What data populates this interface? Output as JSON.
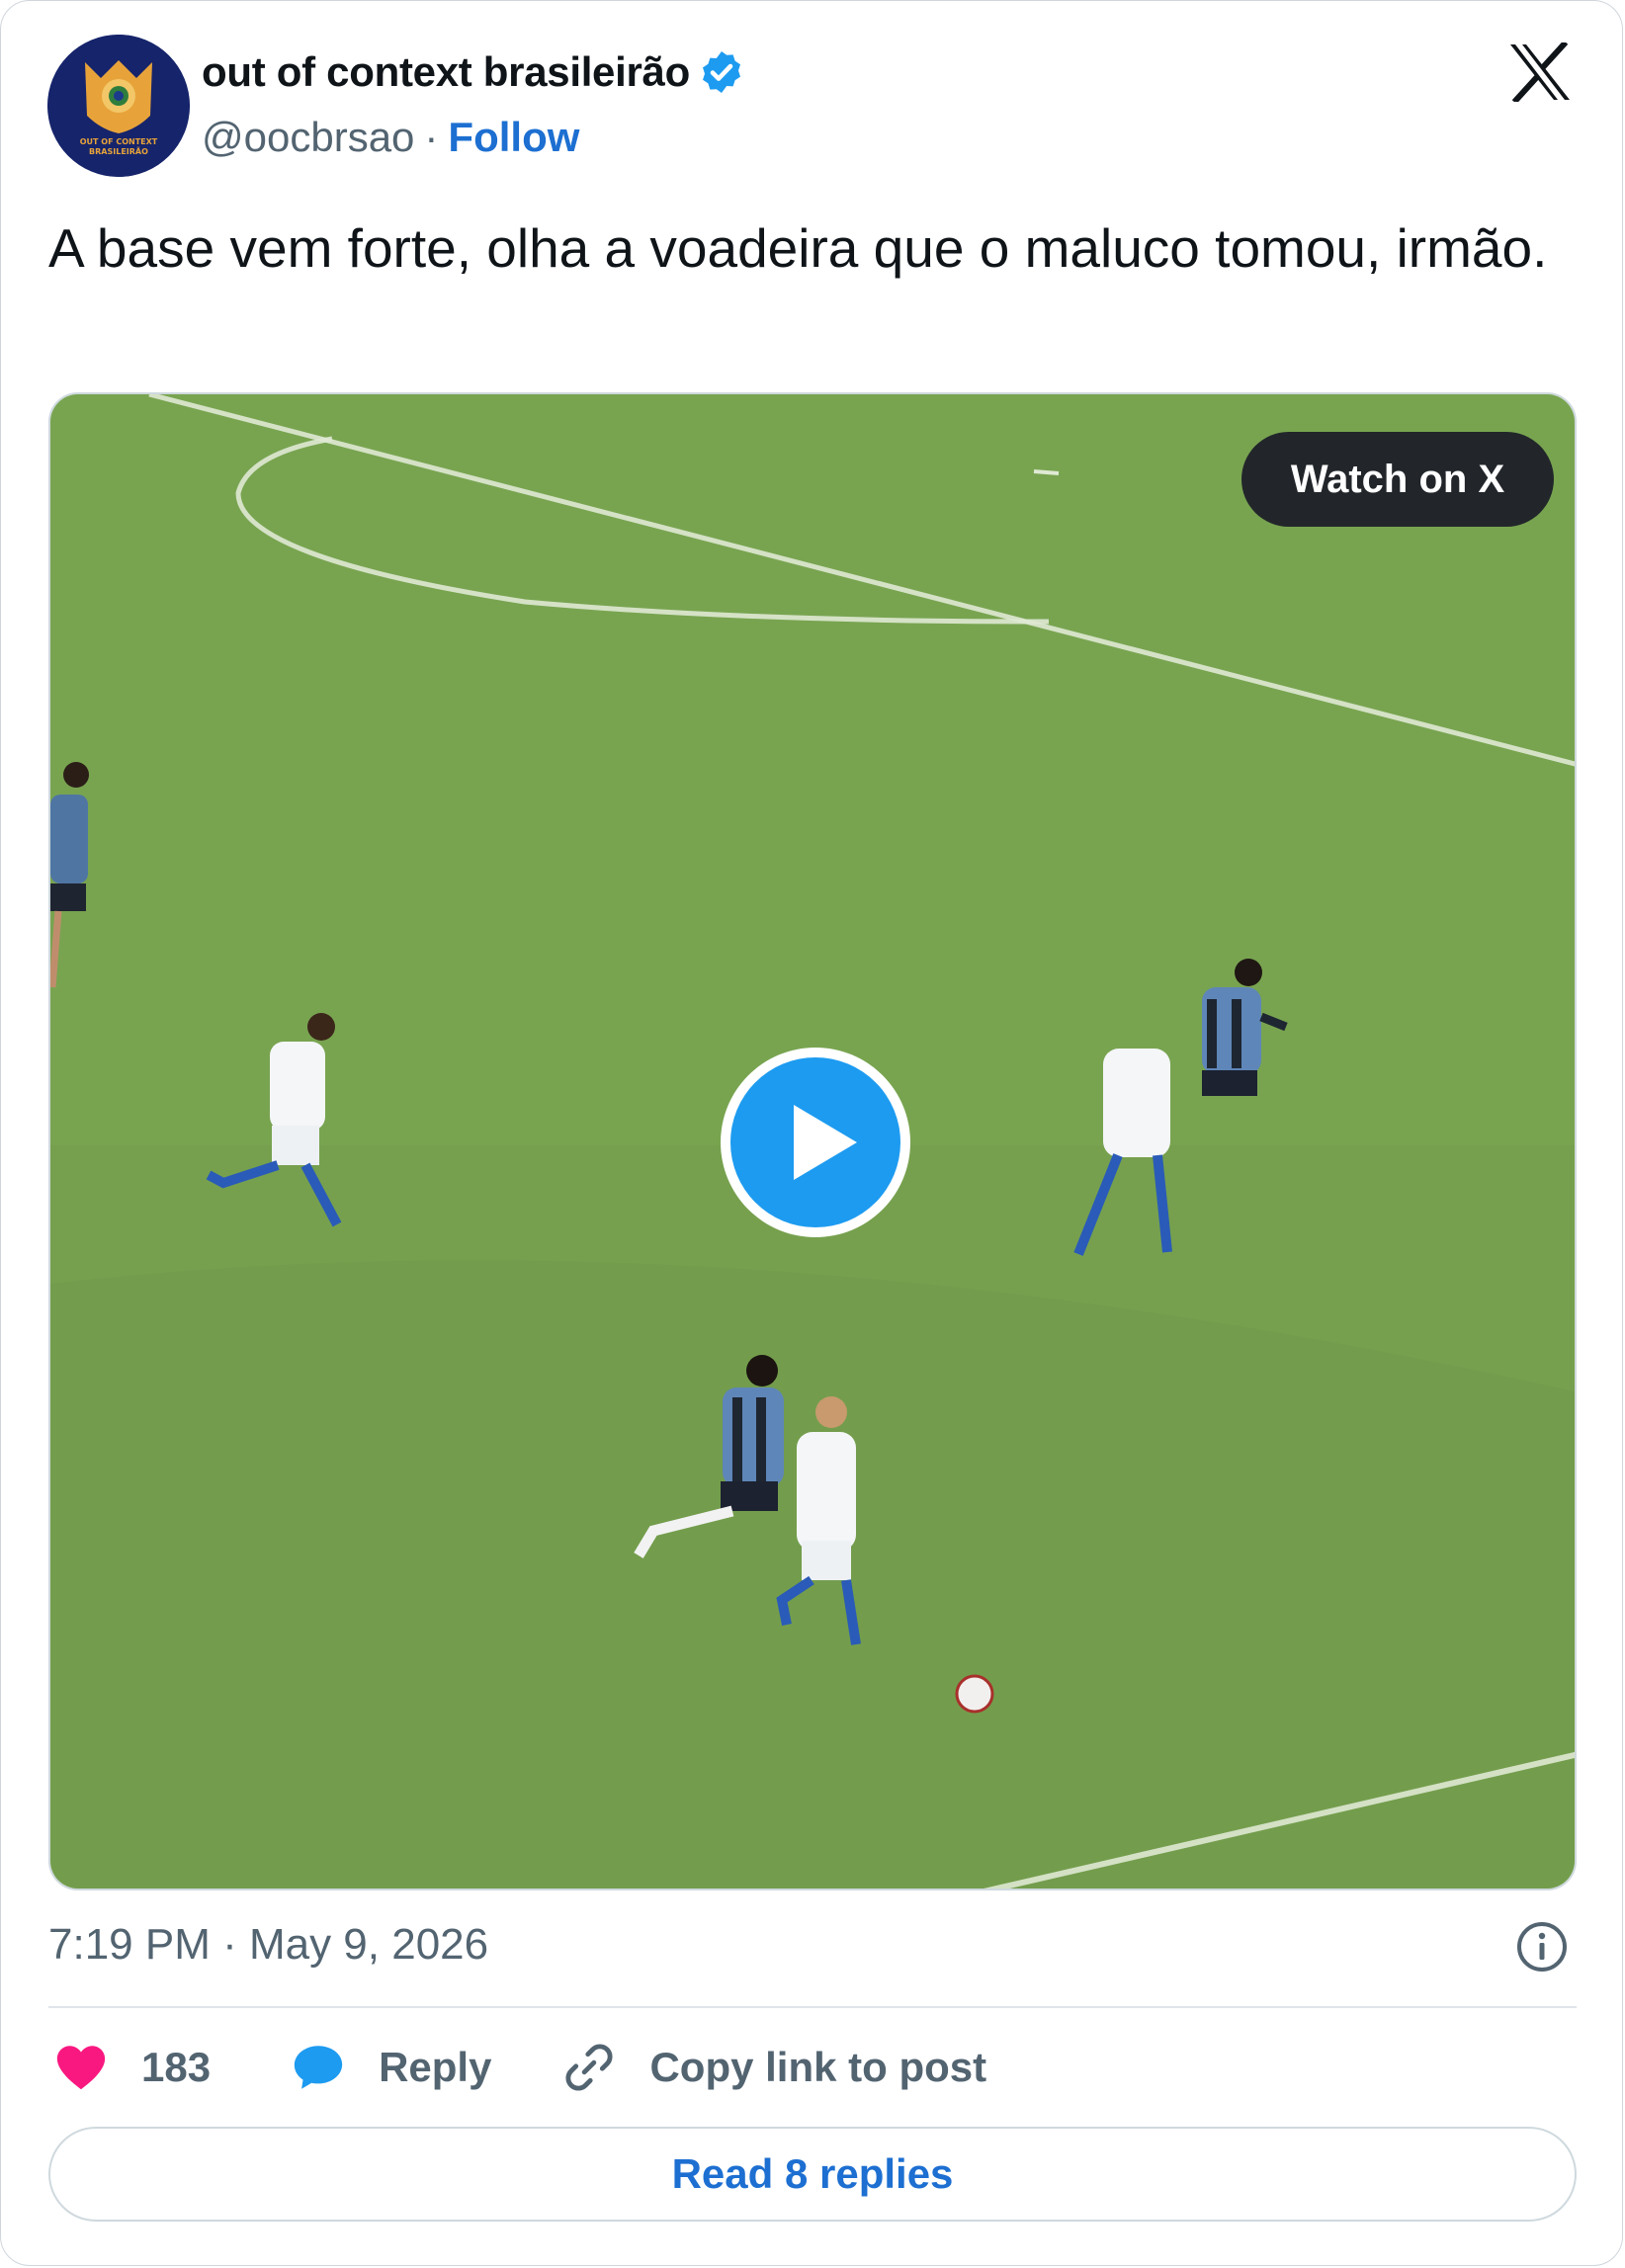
{
  "author": {
    "display_name": "out of context brasileirão",
    "handle": "@oocbrsao",
    "follow_label": "Follow",
    "avatar_text_line1": "OUT OF CONTEXT",
    "avatar_text_line2": "BRASILEIRÃO",
    "verified_icon": "verified-badge-icon"
  },
  "tweet": {
    "text": "A base vem forte, olha a voadeira que o maluco tomou, irmão.",
    "timestamp": "7:19 PM · May 9, 2026"
  },
  "media": {
    "type": "video",
    "watch_label": "Watch on X",
    "play_icon": "play-icon"
  },
  "actions": {
    "like_count": "183",
    "reply_label": "Reply",
    "copy_label": "Copy link to post",
    "read_replies_label": "Read 8 replies"
  },
  "colors": {
    "accent": "#1d9bf0",
    "link": "#1d6fd1",
    "like": "#f91880",
    "pitch": "#76a04e"
  }
}
